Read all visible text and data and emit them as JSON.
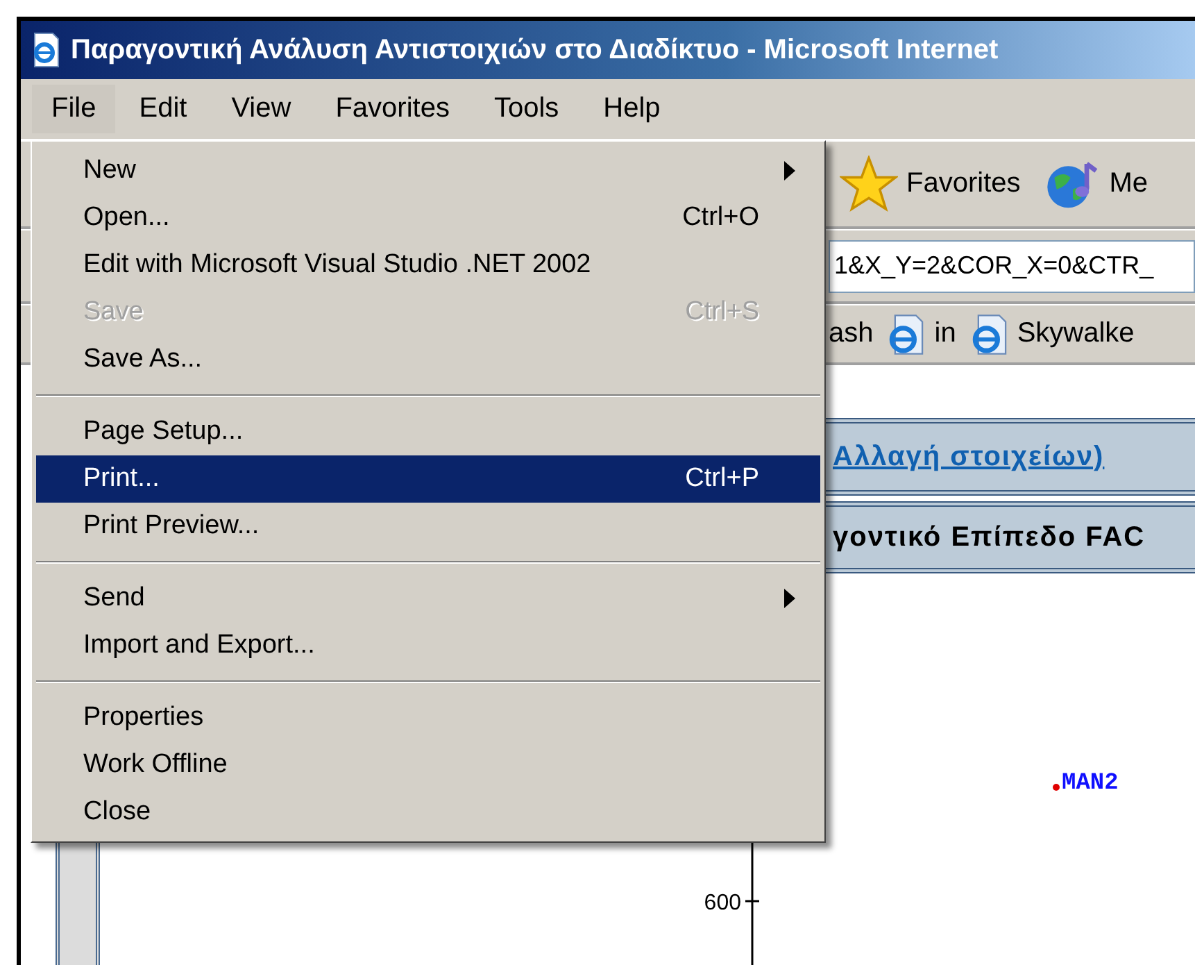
{
  "window": {
    "title": "Παραγοντική Ανάλυση Αντιστοιχιών στο Διαδίκτυο - Microsoft Internet"
  },
  "menu_bar": [
    {
      "label": "File",
      "selected": true
    },
    {
      "label": "Edit",
      "selected": false
    },
    {
      "label": "View",
      "selected": false
    },
    {
      "label": "Favorites",
      "selected": false
    },
    {
      "label": "Tools",
      "selected": false
    },
    {
      "label": "Help",
      "selected": false
    }
  ],
  "file_menu": [
    {
      "kind": "item",
      "label": "New",
      "submenu": true,
      "disabled": false,
      "selected": false
    },
    {
      "kind": "item",
      "label": "Open...",
      "shortcut": "Ctrl+O",
      "disabled": false,
      "selected": false
    },
    {
      "kind": "item",
      "label": "Edit with Microsoft Visual Studio .NET 2002",
      "disabled": false,
      "selected": false
    },
    {
      "kind": "item",
      "label": "Save",
      "shortcut": "Ctrl+S",
      "disabled": true,
      "selected": false
    },
    {
      "kind": "item",
      "label": "Save As...",
      "disabled": false,
      "selected": false
    },
    {
      "kind": "separator"
    },
    {
      "kind": "item",
      "label": "Page Setup...",
      "disabled": false,
      "selected": false
    },
    {
      "kind": "item",
      "label": "Print...",
      "shortcut": "Ctrl+P",
      "disabled": false,
      "selected": true
    },
    {
      "kind": "item",
      "label": "Print Preview...",
      "disabled": false,
      "selected": false
    },
    {
      "kind": "separator"
    },
    {
      "kind": "item",
      "label": "Send",
      "submenu": true,
      "disabled": false,
      "selected": false
    },
    {
      "kind": "item",
      "label": "Import and Export...",
      "disabled": false,
      "selected": false
    },
    {
      "kind": "separator"
    },
    {
      "kind": "item",
      "label": "Properties",
      "disabled": false,
      "selected": false
    },
    {
      "kind": "item",
      "label": "Work Offline",
      "disabled": false,
      "selected": false
    },
    {
      "kind": "item",
      "label": "Close",
      "disabled": false,
      "selected": false
    }
  ],
  "toolbar": [
    {
      "kind": "star",
      "label": "Favorites"
    },
    {
      "kind": "globe",
      "label": "Me"
    }
  ],
  "address": {
    "value": "1&X_Y=2&COR_X=0&CTR_"
  },
  "links": [
    {
      "kind": "text",
      "label": "ash"
    },
    {
      "kind": "page",
      "label": "in"
    },
    {
      "kind": "page",
      "label": "Skywalke"
    }
  ],
  "content": {
    "link": "Αλλαγή στοιχείων)",
    "heading": "γοντικό Επίπεδο FAC",
    "axis_tick": "600",
    "point_label": "MAN2"
  }
}
